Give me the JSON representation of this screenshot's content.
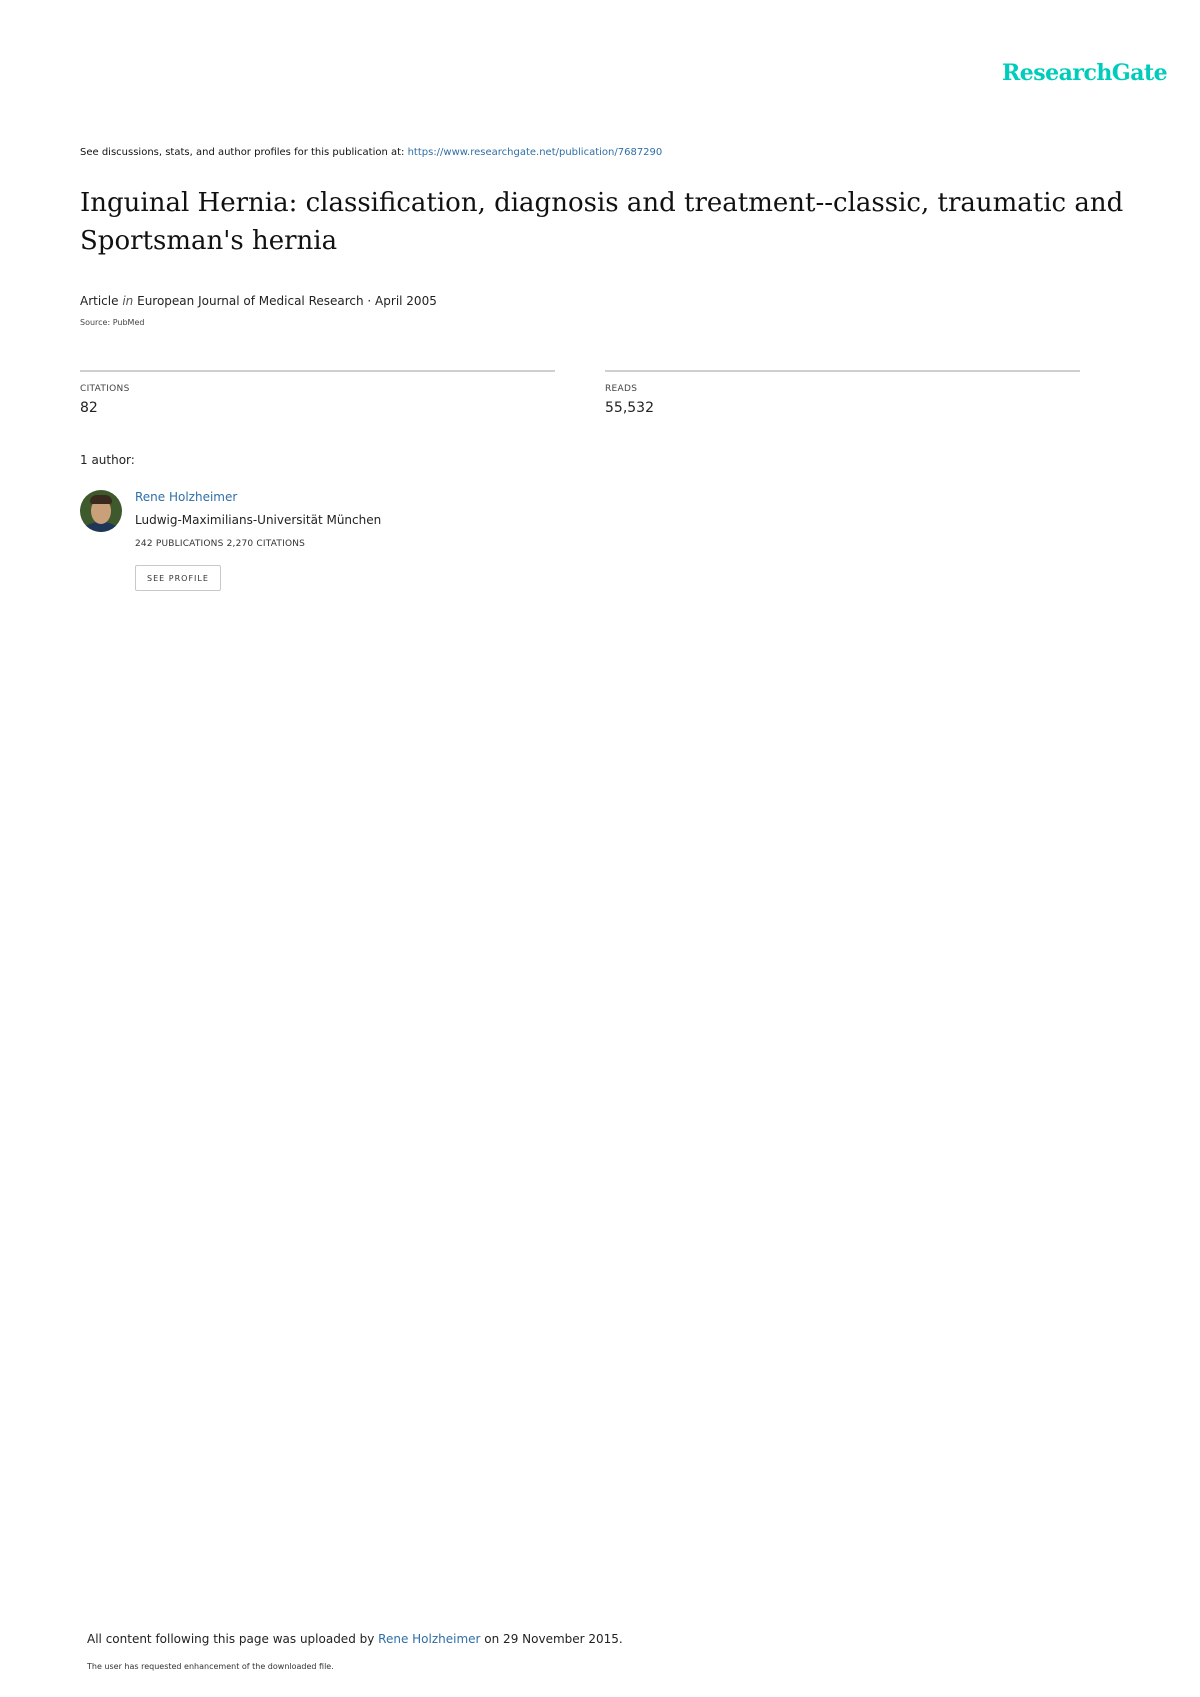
{
  "header": {
    "logo_text": "ResearchGate",
    "logo_color": "#00ccbb"
  },
  "discussion": {
    "prefix": "See discussions, stats, and author profiles for this publication at: ",
    "link": "https://www.researchgate.net/publication/7687290"
  },
  "publication": {
    "title": "Inguinal Hernia: classification, diagnosis and treatment--classic, traumatic and Sportsman's hernia",
    "type": "Article",
    "in_label": "in",
    "journal_date": "European Journal of Medical Research · April 2005",
    "source": "Source: PubMed"
  },
  "stats": {
    "citations_label": "CITATIONS",
    "citations_value": "82",
    "reads_label": "READS",
    "reads_value": "55,532"
  },
  "authors": {
    "heading": "1 author:",
    "items": [
      {
        "name": "Rene Holzheimer",
        "affiliation": "Ludwig-Maximilians-Universität München",
        "stats": "242 PUBLICATIONS   2,270 CITATIONS",
        "button_label": "SEE PROFILE"
      }
    ]
  },
  "footer": {
    "upload_prefix": "All content following this page was uploaded by ",
    "upload_author": "Rene Holzheimer",
    "upload_suffix": " on 29 November 2015.",
    "note": "The user has requested enhancement of the downloaded file."
  },
  "colors": {
    "link": "#2f6ea6",
    "rule": "#cfcfcf"
  }
}
